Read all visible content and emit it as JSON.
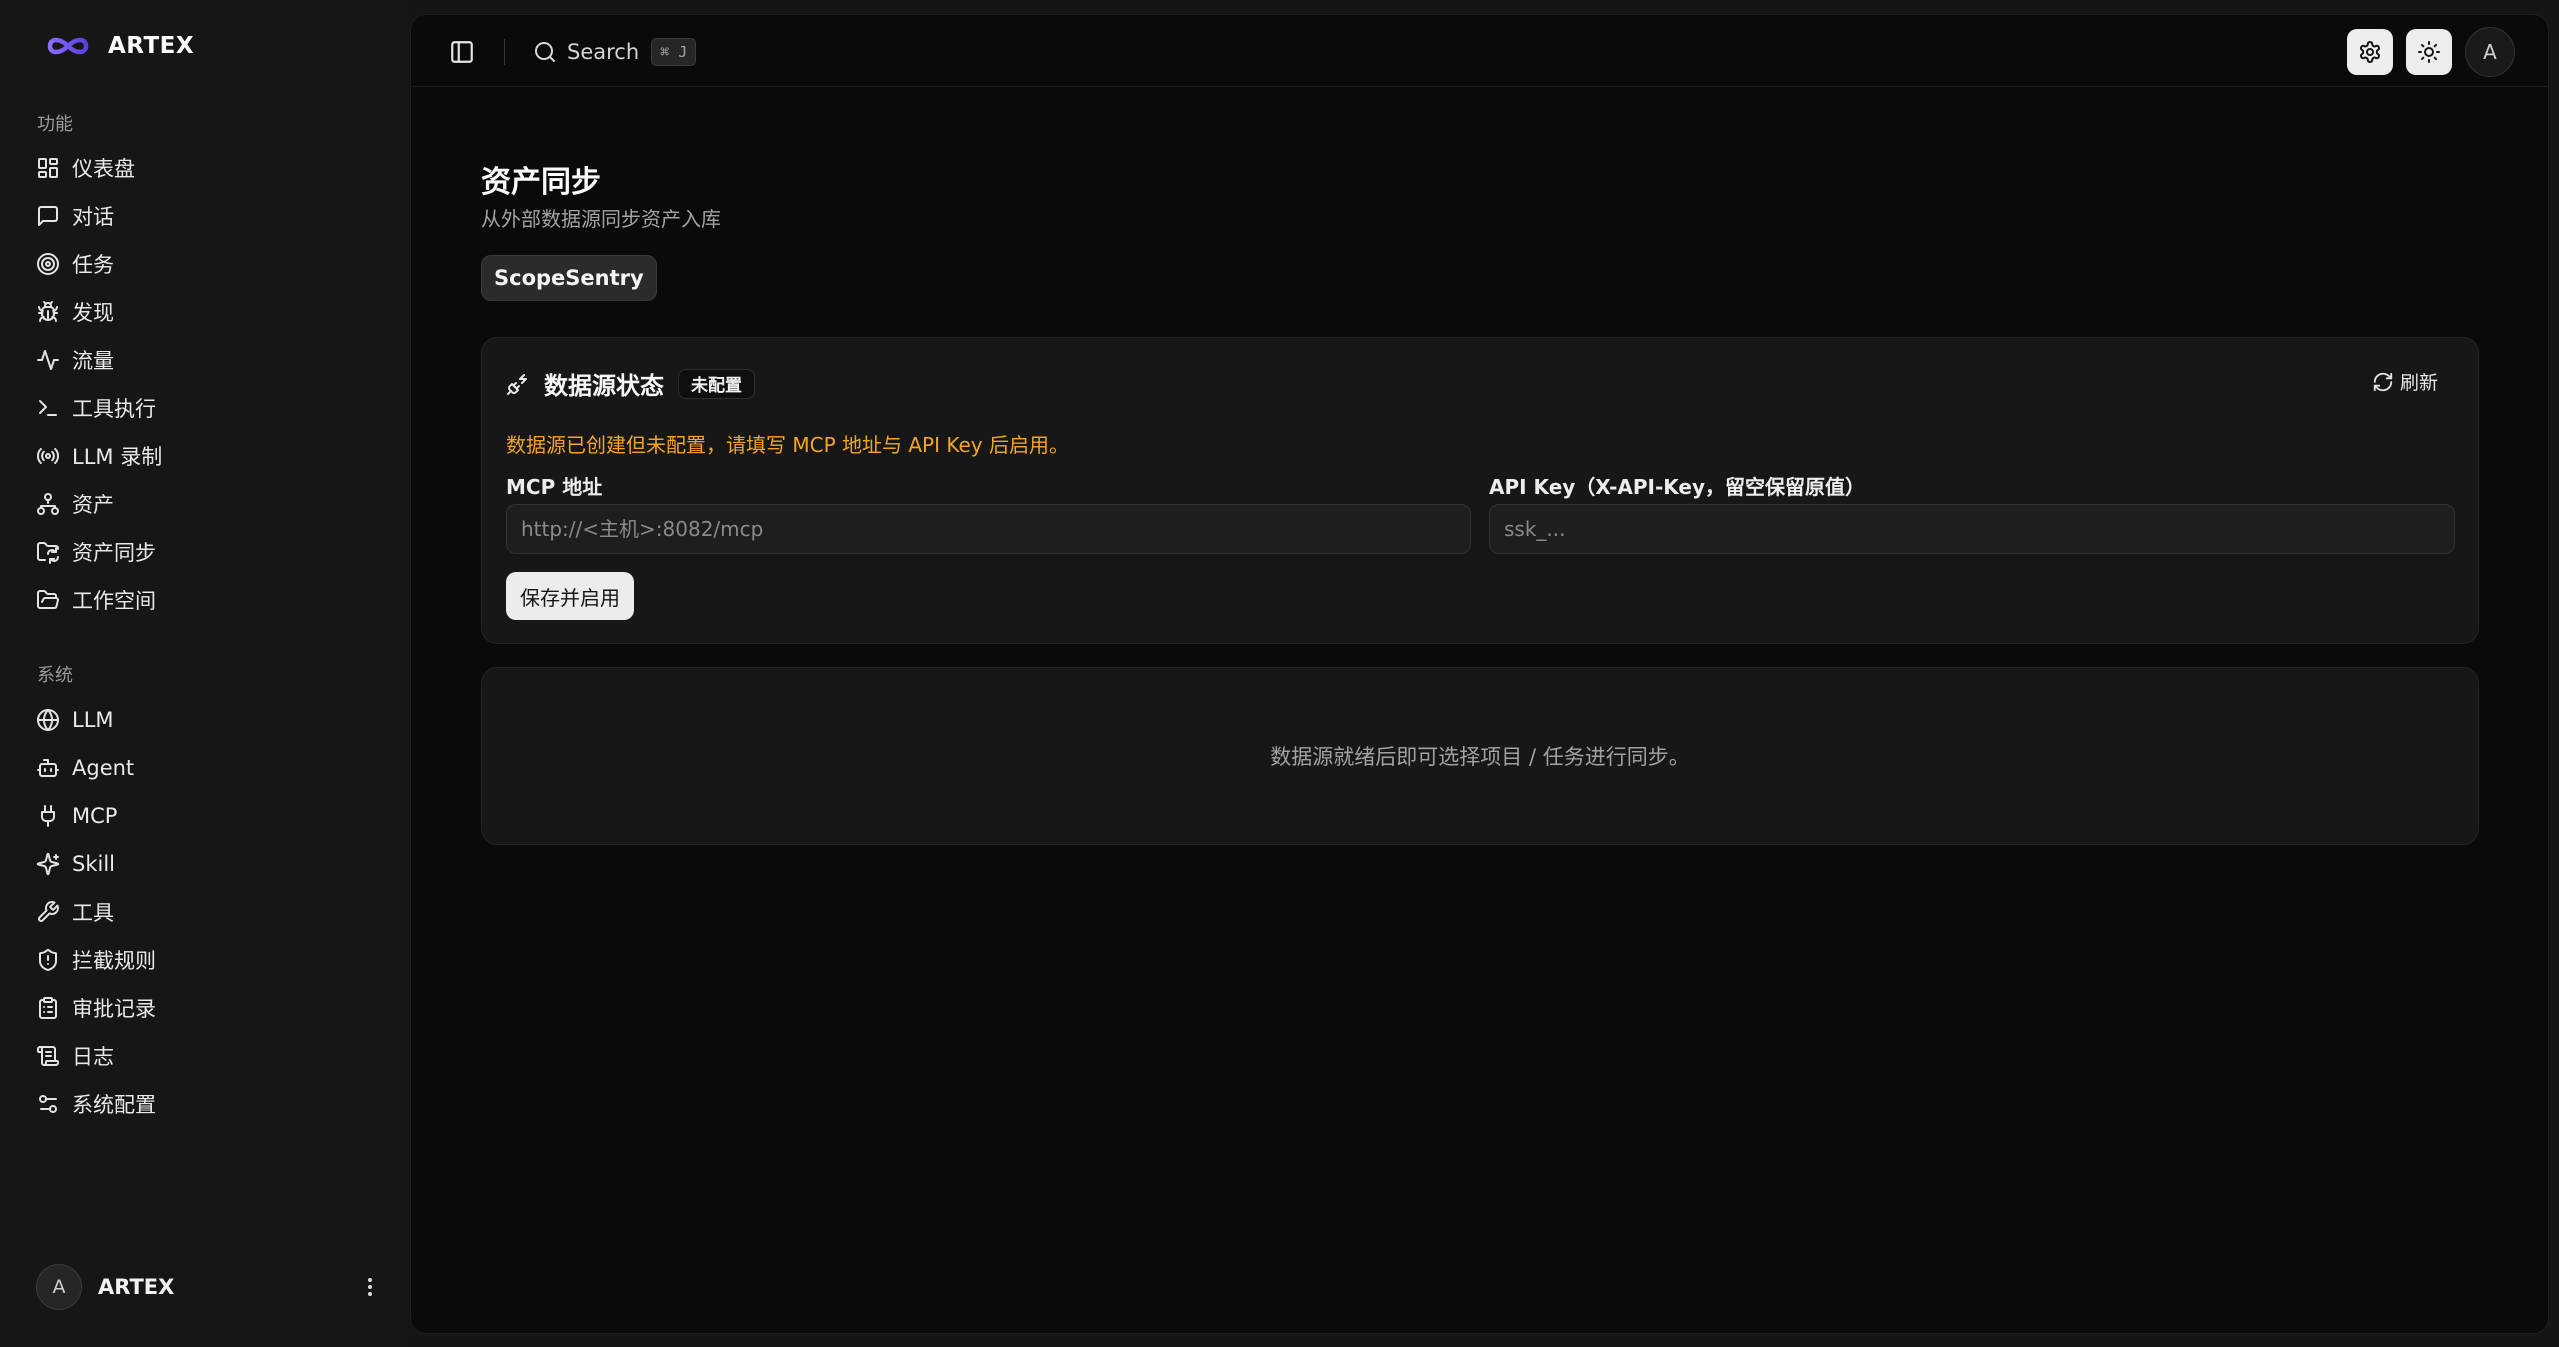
{
  "brand": {
    "name": "ARTEX"
  },
  "sidebar": {
    "groups": [
      {
        "label": "功能",
        "items": [
          {
            "label": "仪表盘",
            "icon": "dashboard-icon"
          },
          {
            "label": "对话",
            "icon": "chat-icon"
          },
          {
            "label": "任务",
            "icon": "target-icon"
          },
          {
            "label": "发现",
            "icon": "bug-icon"
          },
          {
            "label": "流量",
            "icon": "activity-icon"
          },
          {
            "label": "工具执行",
            "icon": "terminal-icon"
          },
          {
            "label": "LLM 录制",
            "icon": "radio-icon"
          },
          {
            "label": "资产",
            "icon": "network-icon"
          },
          {
            "label": "资产同步",
            "icon": "folder-sync-icon"
          },
          {
            "label": "工作空间",
            "icon": "folder-open-icon"
          }
        ]
      },
      {
        "label": "系统",
        "items": [
          {
            "label": "LLM",
            "icon": "brain-icon"
          },
          {
            "label": "Agent",
            "icon": "bot-icon"
          },
          {
            "label": "MCP",
            "icon": "plug-icon"
          },
          {
            "label": "Skill",
            "icon": "sparkles-icon"
          },
          {
            "label": "工具",
            "icon": "wrench-icon"
          },
          {
            "label": "拦截规则",
            "icon": "shield-icon"
          },
          {
            "label": "审批记录",
            "icon": "clipboard-icon"
          },
          {
            "label": "日志",
            "icon": "scroll-icon"
          },
          {
            "label": "系统配置",
            "icon": "settings-sliders-icon"
          }
        ]
      }
    ],
    "user": {
      "avatar": "A",
      "name": "ARTEX"
    }
  },
  "topbar": {
    "search_label": "Search",
    "search_shortcut": "⌘ J",
    "avatar": "A"
  },
  "page": {
    "title": "资产同步",
    "subtitle": "从外部数据源同步资产入库",
    "tab": "ScopeSentry"
  },
  "status_card": {
    "title": "数据源状态",
    "badge": "未配置",
    "refresh_label": "刷新",
    "warning": "数据源已创建但未配置，请填写 MCP 地址与 API Key 后启用。",
    "mcp_label": "MCP 地址",
    "mcp_placeholder": "http://<主机>:8082/mcp",
    "mcp_value": "",
    "apikey_label": "API Key（X-API-Key，留空保留原值）",
    "apikey_placeholder": "ssk_...",
    "apikey_value": "",
    "save_label": "保存并启用"
  },
  "empty_card": {
    "message": "数据源就绪后即可选择项目 / 任务进行同步。"
  },
  "colors": {
    "warning": "#f5a524",
    "brand_logo": "#7c5cff",
    "background": "#0a0a0a"
  }
}
